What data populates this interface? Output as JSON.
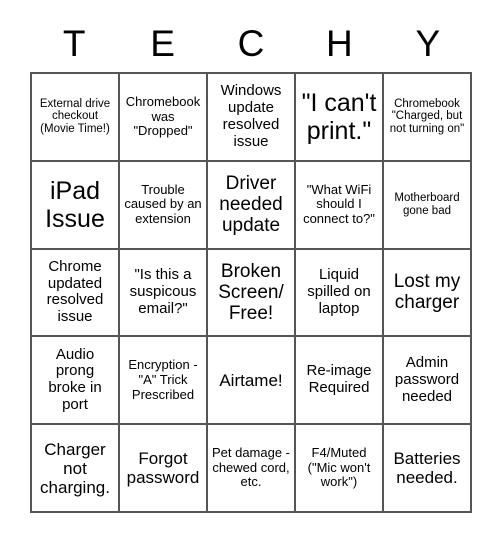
{
  "card": {
    "title": "TECHY",
    "header_letters": [
      "T",
      "E",
      "C",
      "H",
      "Y"
    ],
    "grid_size": "5x5",
    "colors": {
      "border": "#555555",
      "text": "#000000",
      "background": "#ffffff"
    },
    "rows": [
      [
        {
          "text": "External drive checkout (Movie Time!)",
          "size": "fs-xs"
        },
        {
          "text": "Chromebook was \"Dropped\"",
          "size": "fs-sm"
        },
        {
          "text": "Windows update resolved issue",
          "size": "fs-md"
        },
        {
          "text": "\"I can't print.\"",
          "size": "fs-xxl"
        },
        {
          "text": "Chromebook \"Charged, but not turning on\"",
          "size": "fs-xs"
        }
      ],
      [
        {
          "text": "iPad Issue",
          "size": "fs-xxl"
        },
        {
          "text": "Trouble caused by an extension",
          "size": "fs-sm"
        },
        {
          "text": "Driver needed update",
          "size": "fs-xl"
        },
        {
          "text": "\"What WiFi should I connect to?\"",
          "size": "fs-sm"
        },
        {
          "text": "Motherboard gone bad",
          "size": "fs-xs"
        }
      ],
      [
        {
          "text": "Chrome updated resolved issue",
          "size": "fs-md"
        },
        {
          "text": "\"Is this a suspicous email?\"",
          "size": "fs-md"
        },
        {
          "text": "Broken Screen/ Free!",
          "size": "fs-xl"
        },
        {
          "text": "Liquid spilled on laptop",
          "size": "fs-md"
        },
        {
          "text": "Lost my charger",
          "size": "fs-xl"
        }
      ],
      [
        {
          "text": "Audio prong broke in port",
          "size": "fs-md"
        },
        {
          "text": "Encryption - \"A\" Trick Prescribed",
          "size": "fs-sm"
        },
        {
          "text": "Airtame!",
          "size": "fs-lg"
        },
        {
          "text": "Re-image Required",
          "size": "fs-md"
        },
        {
          "text": "Admin password needed",
          "size": "fs-md"
        }
      ],
      [
        {
          "text": "Charger not charging.",
          "size": "fs-lg"
        },
        {
          "text": "Forgot password",
          "size": "fs-lg"
        },
        {
          "text": "Pet damage - chewed cord, etc.",
          "size": "fs-sm"
        },
        {
          "text": "F4/Muted (\"Mic won't work\")",
          "size": "fs-sm"
        },
        {
          "text": "Batteries needed.",
          "size": "fs-lg"
        }
      ]
    ]
  }
}
